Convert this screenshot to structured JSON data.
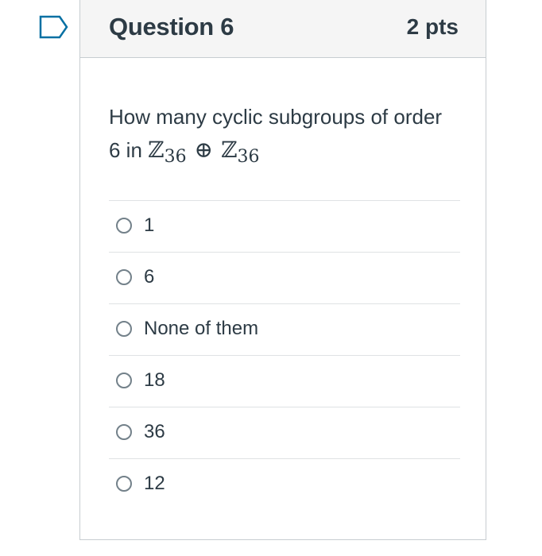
{
  "question": {
    "title": "Question 6",
    "points": "2 pts",
    "text_intro": "How many cyclic subgroups of order",
    "text_line2_prefix": "6 in",
    "math": {
      "set_symbol": "ℤ",
      "subscript": "36",
      "operator": "⊕"
    }
  },
  "answers": [
    {
      "label": "1"
    },
    {
      "label": "6"
    },
    {
      "label": "None of them"
    },
    {
      "label": "18"
    },
    {
      "label": "36"
    },
    {
      "label": "12"
    }
  ],
  "icons": {
    "flag": "bookmark-flag-icon",
    "radio": "radio-button-icon"
  },
  "colors": {
    "text": "#2d3b45",
    "header_bg": "#f5f5f5",
    "flag_blue": "#0770a3",
    "border": "#c7cdd1"
  }
}
